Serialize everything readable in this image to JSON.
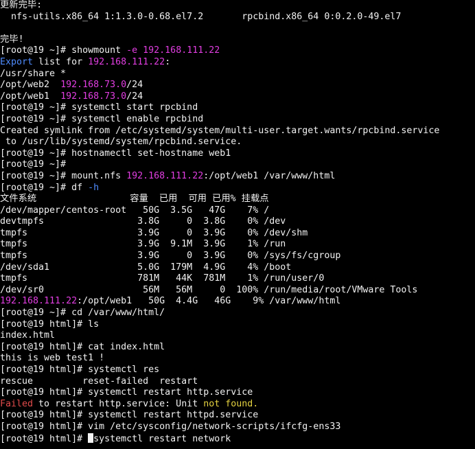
{
  "terminal": {
    "colors": {
      "background": "#000000",
      "text": "#f2f2f2",
      "magenta": "#e23ee2",
      "blue": "#4f8cff",
      "red": "#e24b4b",
      "yellow": "#e6d340"
    },
    "lines": [
      [
        {
          "t": "更新完毕:"
        }
      ],
      [
        {
          "t": "  nfs-utils.x86_64 1:1.3.0-0.68.el7.2       rpcbind.x86_64 0:0.2.0-49.el7"
        }
      ],
      [
        {
          "t": ""
        }
      ],
      [
        {
          "t": "完毕!"
        }
      ],
      [
        {
          "t": "[root@19 ~]# showmount "
        },
        {
          "t": "-e",
          "c": "magenta"
        },
        {
          "t": " "
        },
        {
          "t": "192.168.111.22",
          "c": "magenta"
        }
      ],
      [
        {
          "t": "Export",
          "c": "blue"
        },
        {
          "t": " list for "
        },
        {
          "t": "192.168.111.22",
          "c": "magenta"
        },
        {
          "t": ":"
        }
      ],
      [
        {
          "t": "/usr/share *"
        }
      ],
      [
        {
          "t": "/opt/web2  "
        },
        {
          "t": "192.168.73.0",
          "c": "magenta"
        },
        {
          "t": "/24"
        }
      ],
      [
        {
          "t": "/opt/web1  "
        },
        {
          "t": "192.168.73.0",
          "c": "magenta"
        },
        {
          "t": "/24"
        }
      ],
      [
        {
          "t": "[root@19 ~]# systemctl start rpcbind"
        }
      ],
      [
        {
          "t": "[root@19 ~]# systemctl enable rpcbind"
        }
      ],
      [
        {
          "t": "Created symlink from /etc/systemd/system/multi-user.target.wants/rpcbind.service"
        }
      ],
      [
        {
          "t": " to /usr/lib/systemd/system/rpcbind.service."
        }
      ],
      [
        {
          "t": "[root@19 ~]# hostnamectl set-hostname web1"
        }
      ],
      [
        {
          "t": "[root@19 ~]#"
        }
      ],
      [
        {
          "t": "[root@19 ~]# mount.nfs "
        },
        {
          "t": "192.168.111.22",
          "c": "magenta"
        },
        {
          "t": ":/opt/web1 /var/www/html"
        }
      ],
      [
        {
          "t": "[root@19 ~]# df "
        },
        {
          "t": "-h",
          "c": "blue"
        }
      ],
      [
        {
          "t": "文件系统                 容量  已用  可用 已用% 挂载点"
        }
      ],
      [
        {
          "t": "/dev/mapper/centos-root   50G  3.5G   47G    7% /"
        }
      ],
      [
        {
          "t": "devtmpfs                 3.8G     0  3.8G    0% /dev"
        }
      ],
      [
        {
          "t": "tmpfs                    3.9G     0  3.9G    0% /dev/shm"
        }
      ],
      [
        {
          "t": "tmpfs                    3.9G  9.1M  3.9G    1% /run"
        }
      ],
      [
        {
          "t": "tmpfs                    3.9G     0  3.9G    0% /sys/fs/cgroup"
        }
      ],
      [
        {
          "t": "/dev/sda1                5.0G  179M  4.9G    4% /boot"
        }
      ],
      [
        {
          "t": "tmpfs                    781M   44K  781M    1% /run/user/0"
        }
      ],
      [
        {
          "t": "/dev/sr0                  56M   56M     0  100% /run/media/root/VMware Tools"
        }
      ],
      [
        {
          "t": "192.168.111.22",
          "c": "magenta"
        },
        {
          "t": ":/opt/web1   50G  4.4G   46G    9% /var/www/html"
        }
      ],
      [
        {
          "t": "[root@19 ~]# cd /var/www/html/"
        }
      ],
      [
        {
          "t": "[root@19 html]# ls"
        }
      ],
      [
        {
          "t": "index.html"
        }
      ],
      [
        {
          "t": "[root@19 html]# cat index.html"
        }
      ],
      [
        {
          "t": "this is web test1 !"
        }
      ],
      [
        {
          "t": "[root@19 html]# systemctl res"
        }
      ],
      [
        {
          "t": "rescue         reset-failed  restart"
        }
      ],
      [
        {
          "t": "[root@19 html]# systemctl restart http.service"
        }
      ],
      [
        {
          "t": "Failed",
          "c": "red"
        },
        {
          "t": " to restart http.service: Unit "
        },
        {
          "t": "not found.",
          "c": "yellow"
        }
      ],
      [
        {
          "t": "[root@19 html]# systemctl restart httpd.service"
        }
      ],
      [
        {
          "t": "[root@19 html]# vim /etc/sysconfig/network-scripts/ifcfg-ens33"
        }
      ],
      [
        {
          "t": "[root@19 html]# "
        },
        {
          "t": "",
          "cursor": true
        },
        {
          "t": "systemctl restart network"
        }
      ]
    ]
  }
}
